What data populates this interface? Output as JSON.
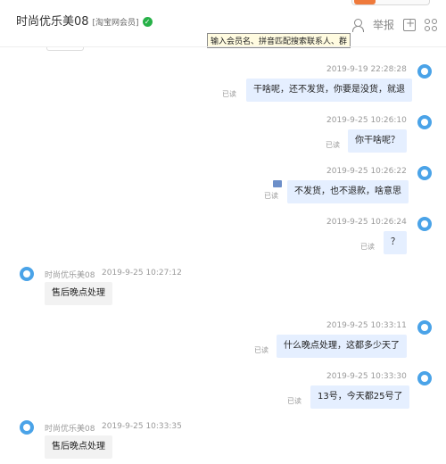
{
  "header": {
    "title": "时尚优乐美08",
    "tag": "[淘宝网会员]",
    "report_label": "举报"
  },
  "search": {
    "tooltip": "输入会员名、拼音匹配搜索联系人、群"
  },
  "messages": [
    {
      "side": "right",
      "time": "2019-9-19 22:28:28",
      "text": "干啥呢，还不发货，你要是没货，就退",
      "read": "已读"
    },
    {
      "side": "right",
      "time": "2019-9-25 10:26:10",
      "text": "你干啥呢？",
      "read": "已读"
    },
    {
      "side": "right",
      "time": "2019-9-25 10:26:22",
      "text": "不发货，也不退款，啥意思",
      "read": "已读"
    },
    {
      "side": "right",
      "time": "2019-9-25 10:26:24",
      "text": "？",
      "read": "已读"
    },
    {
      "side": "left",
      "sender": "时尚优乐美08",
      "time": "2019-9-25 10:27:12",
      "text": "售后晚点处理"
    },
    {
      "side": "right",
      "time": "2019-9-25 10:33:11",
      "text": "什么晚点处理，这都多少天了",
      "read": "已读"
    },
    {
      "side": "right",
      "time": "2019-9-25 10:33:30",
      "text": "13号，今天都25号了",
      "read": "已读"
    },
    {
      "side": "left",
      "sender": "时尚优乐美08",
      "time": "2019-9-25 10:33:35",
      "text": "售后晚点处理"
    }
  ]
}
